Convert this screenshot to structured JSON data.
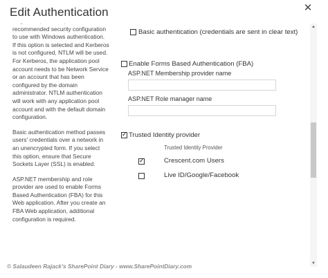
{
  "dialog": {
    "title": "Edit Authentication",
    "close_glyph": "✕"
  },
  "help": {
    "paragraphs": [
      "Negotiate (Kerberos) is the recommended security configuration to use with Windows authentication. If this option is selected and Kerberos is not configured, NTLM will be used. For Kerberos, the application pool account needs to be Network Service or an account that has been configured by the domain administrator. NTLM authentication will work with any application pool account and with the default domain configuration.",
      "Basic authentication method passes users' credentials over a network in an unencrypted form. If you select this option, ensure that Secure Sockets Layer (SSL) is enabled.",
      "ASP.NET membership and role provider are used to enable Forms Based Authentication (FBA) for this Web application. After you create an FBA Web application, additional configuration is required."
    ]
  },
  "options": {
    "basic_auth": {
      "label": "Basic authentication (credentials are sent in clear text)",
      "checked": false
    },
    "fba": {
      "label": "Enable Forms Based Authentication (FBA)",
      "checked": false,
      "membership_label": "ASP.NET Membership provider name",
      "membership_value": "",
      "role_label": "ASP.NET Role manager name",
      "role_value": ""
    },
    "trusted": {
      "label": "Trusted Identity provider",
      "checked": true,
      "column_header": "Trusted Identity Provider",
      "providers": [
        {
          "label": "Crescent.com Users",
          "checked": true
        },
        {
          "label": "Live ID/Google/Facebook",
          "checked": false
        }
      ]
    }
  },
  "scrollbar": {
    "up_glyph": "▲",
    "down_glyph": "▼"
  },
  "watermark": "© Salaudeen Rajack's SharePoint Diary - www.SharePointDiary.com",
  "colors": {
    "text": "#444444",
    "border": "#d5d5d5",
    "thumb": "#c8c8c8"
  }
}
